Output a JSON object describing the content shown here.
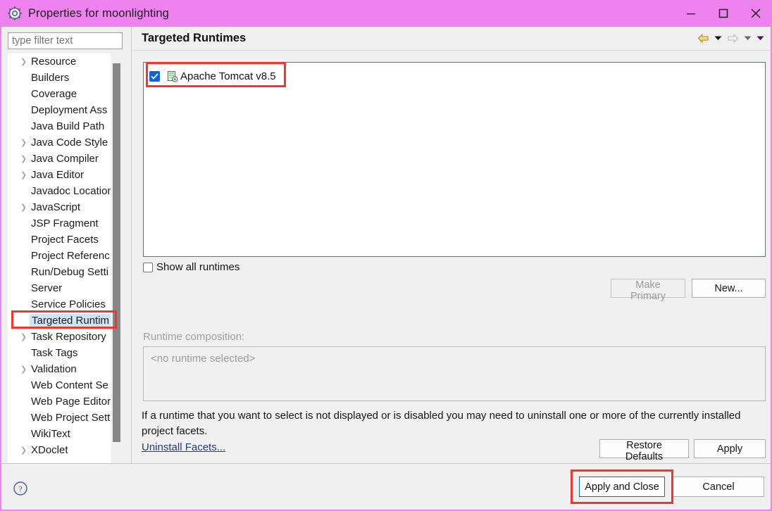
{
  "window": {
    "title": "Properties for moonlighting",
    "icon": "gear-icon",
    "minimize_label": "Minimize",
    "maximize_label": "Maximize",
    "close_label": "Close",
    "border_color": "#ee82ee",
    "titlebar_color": "#ee82ee"
  },
  "sidebar": {
    "filter": {
      "value": "",
      "placeholder": "type filter text"
    },
    "items": [
      {
        "label": "Resource",
        "expandable": true,
        "selected": false
      },
      {
        "label": "Builders",
        "expandable": false,
        "selected": false
      },
      {
        "label": "Coverage",
        "expandable": false,
        "selected": false
      },
      {
        "label": "Deployment Ass",
        "expandable": false,
        "selected": false
      },
      {
        "label": "Java Build Path",
        "expandable": false,
        "selected": false
      },
      {
        "label": "Java Code Style",
        "expandable": true,
        "selected": false
      },
      {
        "label": "Java Compiler",
        "expandable": true,
        "selected": false
      },
      {
        "label": "Java Editor",
        "expandable": true,
        "selected": false
      },
      {
        "label": "Javadoc Location",
        "expandable": false,
        "selected": false
      },
      {
        "label": "JavaScript",
        "expandable": true,
        "selected": false
      },
      {
        "label": "JSP Fragment",
        "expandable": false,
        "selected": false
      },
      {
        "label": "Project Facets",
        "expandable": false,
        "selected": false
      },
      {
        "label": "Project Referenc",
        "expandable": false,
        "selected": false
      },
      {
        "label": "Run/Debug Setti",
        "expandable": false,
        "selected": false
      },
      {
        "label": "Server",
        "expandable": false,
        "selected": false
      },
      {
        "label": "Service Policies",
        "expandable": false,
        "selected": false
      },
      {
        "label": "Targeted Runtim",
        "expandable": false,
        "selected": true
      },
      {
        "label": "Task Repository",
        "expandable": true,
        "selected": false
      },
      {
        "label": "Task Tags",
        "expandable": false,
        "selected": false
      },
      {
        "label": "Validation",
        "expandable": true,
        "selected": false
      },
      {
        "label": "Web Content Se",
        "expandable": false,
        "selected": false
      },
      {
        "label": "Web Page Editor",
        "expandable": false,
        "selected": false
      },
      {
        "label": "Web Project Sett",
        "expandable": false,
        "selected": false
      },
      {
        "label": "WikiText",
        "expandable": false,
        "selected": false
      },
      {
        "label": "XDoclet",
        "expandable": true,
        "selected": false
      }
    ]
  },
  "page": {
    "title": "Targeted Runtimes",
    "nav": {
      "back_icon": "back-arrow-icon",
      "back_menu_icon": "chevron-down-icon",
      "forward_icon": "forward-arrow-icon",
      "forward_menu_icon": "chevron-down-icon",
      "view_menu_icon": "chevron-down-icon"
    },
    "runtimes": [
      {
        "label": "Apache Tomcat v8.5",
        "checked": true,
        "icon": "server-icon"
      }
    ],
    "show_all_runtimes": {
      "label": "Show all runtimes",
      "checked": false
    },
    "make_primary_label": "Make Primary",
    "make_primary_enabled": false,
    "new_label": "New...",
    "composition_label": "Runtime composition:",
    "composition_value": "<no runtime selected>",
    "description": "If a runtime that you want to select is not displayed or is disabled you may need to uninstall one or more of the currently installed project facets.",
    "uninstall_link": "Uninstall Facets...",
    "restore_defaults_label": "Restore Defaults",
    "apply_label": "Apply"
  },
  "footer": {
    "help_icon": "help-icon",
    "apply_and_close_label": "Apply and Close",
    "cancel_label": "Cancel"
  },
  "annotations": {
    "color": "#f5342b",
    "boxes": [
      "targeted-runtimes-tree-item",
      "apache-tomcat-runtime-row",
      "apply-and-close-button"
    ]
  }
}
